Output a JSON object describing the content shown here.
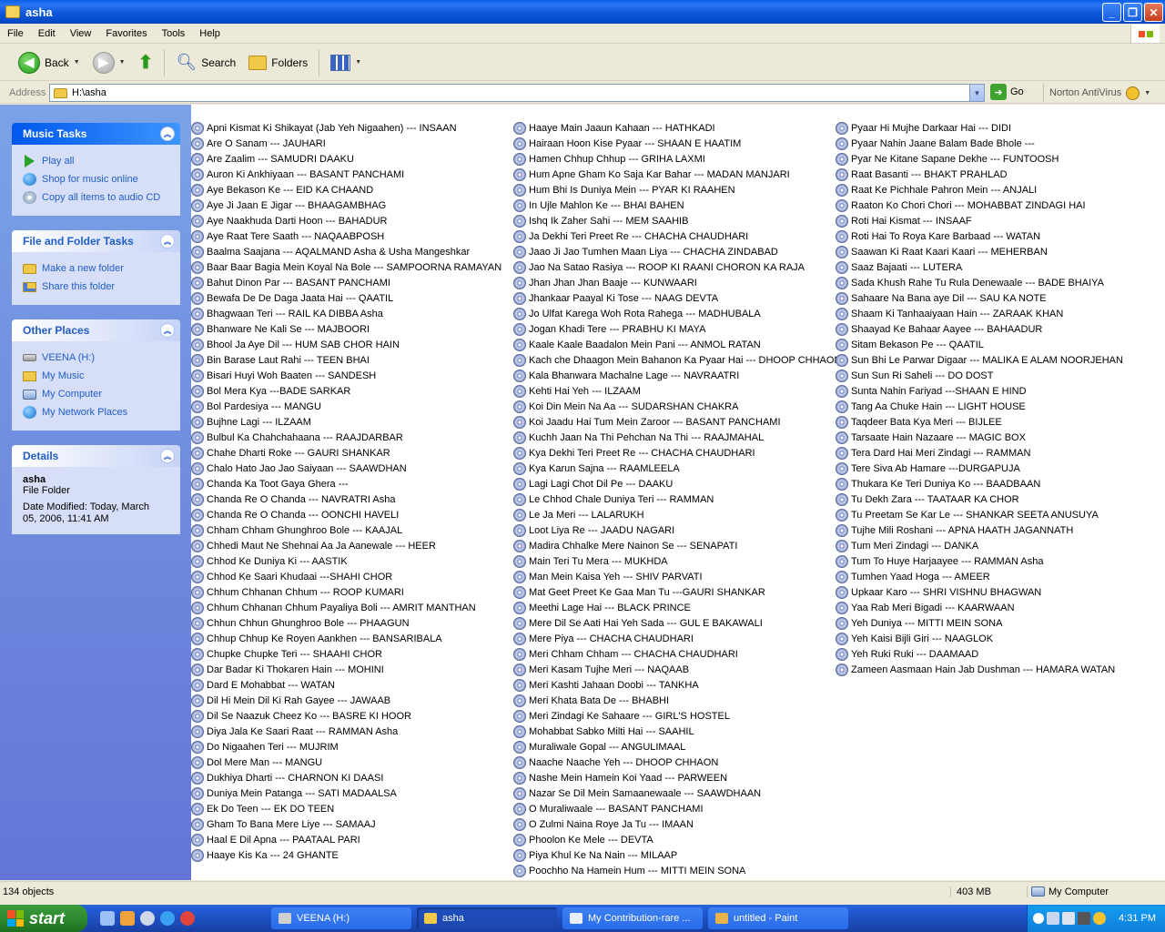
{
  "window": {
    "title": "asha"
  },
  "menu": [
    "File",
    "Edit",
    "View",
    "Favorites",
    "Tools",
    "Help"
  ],
  "toolbar": {
    "back": "Back",
    "search": "Search",
    "folders": "Folders"
  },
  "address": {
    "label": "Address",
    "path": "H:\\asha",
    "go": "Go",
    "norton": "Norton AntiVirus"
  },
  "taskpane": {
    "music_tasks": {
      "title": "Music Tasks",
      "items": [
        "Play all",
        "Shop for music online",
        "Copy all items to audio CD"
      ]
    },
    "file_folder_tasks": {
      "title": "File and Folder Tasks",
      "items": [
        "Make a new folder",
        "Share this folder"
      ]
    },
    "other_places": {
      "title": "Other Places",
      "items": [
        "VEENA (H:)",
        "My Music",
        "My Computer",
        "My Network Places"
      ]
    },
    "details": {
      "title": "Details",
      "name": "asha",
      "type": "File Folder",
      "modified_1": "Date Modified: Today, March",
      "modified_2": "05, 2006, 11:41 AM"
    }
  },
  "files": {
    "col1": [
      "Apni Kismat Ki Shikayat (Jab Yeh Nigaahen) --- INSAAN",
      "Are O Sanam --- JAUHARI",
      "Are Zaalim --- SAMUDRI DAAKU",
      "Auron Ki Ankhiyaan --- BASANT PANCHAMI",
      "Aye Bekason Ke --- EID KA CHAAND",
      "Aye Ji Jaan E Jigar --- BHAAGAMBHAG",
      "Aye Naakhuda Darti Hoon --- BAHADUR",
      "Aye Raat Tere Saath --- NAQAABPOSH",
      "Baalma Saajana --- AQALMAND   Asha & Usha Mangeshkar",
      "Baar Baar Bagia Mein Koyal Na Bole --- SAMPOORNA RAMAYAN",
      "Bahut Dinon Par --- BASANT PANCHAMI",
      "Bewafa De De Daga Jaata Hai --- QAATIL",
      "Bhagwaan Teri --- RAIL KA DIBBA  Asha",
      "Bhanware Ne Kali Se --- MAJBOORI",
      "Bhool Ja Aye Dil --- HUM SAB CHOR HAIN",
      "Bin Barase Laut Rahi --- TEEN BHAI",
      "Bisari Huyi Woh Baaten --- SANDESH",
      "Bol Mera Kya ---BADE SARKAR",
      "Bol Pardesiya --- MANGU",
      "Bujhne Lagi --- ILZAAM",
      "Bulbul Ka Chahchahaana --- RAAJDARBAR",
      "Chahe Dharti Roke --- GAURI SHANKAR",
      "Chalo Hato Jao Jao Saiyaan --- SAAWDHAN",
      "Chanda Ka Toot Gaya Ghera ---",
      "Chanda Re O Chanda --- NAVRATRI  Asha",
      "Chanda Re O Chanda --- OONCHI HAVELI",
      "Chham Chham Ghunghroo Bole --- KAAJAL",
      "Chhedi Maut Ne Shehnai Aa Ja Aanewale --- HEER",
      "Chhod Ke Duniya Ki --- AASTIK",
      "Chhod Ke Saari Khudaai ---SHAHI CHOR",
      "Chhum Chhanan Chhum --- ROOP KUMARI",
      "Chhum Chhanan Chhum Payaliya Boli --- AMRIT MANTHAN",
      "Chhun Chhun Ghunghroo Bole --- PHAAGUN",
      "Chhup Chhup Ke Royen Aankhen --- BANSARIBALA",
      "Chupke Chupke Teri --- SHAAHI CHOR",
      "Dar Badar Ki Thokaren Hain --- MOHINI",
      "Dard E Mohabbat --- WATAN",
      "Dil Hi Mein Dil Ki Rah Gayee --- JAWAAB",
      "Dil Se Naazuk Cheez Ko --- BASRE KI HOOR",
      "Diya Jala Ke Saari Raat --- RAMMAN  Asha",
      "Do Nigaahen Teri --- MUJRIM",
      "Dol Mere Man --- MANGU",
      "Dukhiya Dharti --- CHARNON KI DAASI",
      "Duniya Mein Patanga --- SATI MADAALSA",
      "Ek Do Teen --- EK DO TEEN",
      "Gham To Bana Mere Liye --- SAMAAJ",
      "Haal E Dil Apna --- PAATAAL PARI",
      "Haaye Kis Ka --- 24 GHANTE"
    ],
    "col2": [
      "Haaye Main Jaaun Kahaan --- HATHKADI",
      "Hairaan Hoon Kise Pyaar --- SHAAN E HAATIM",
      "Hamen Chhup Chhup --- GRIHA LAXMI",
      "Hum Apne Gham Ko Saja Kar Bahar --- MADAN MANJARI",
      "Hum Bhi Is Duniya Mein --- PYAR KI RAAHEN",
      "In Ujle Mahlon Ke --- BHAI BAHEN",
      "Ishq Ik Zaher Sahi --- MEM SAAHIB",
      "Ja Dekhi Teri Preet Re --- CHACHA CHAUDHARI",
      "Jaao Ji Jao Tumhen Maan Liya --- CHACHA ZINDABAD",
      "Jao Na Satao Rasiya --- ROOP KI RAANI CHORON KA RAJA",
      "Jhan Jhan Jhan Baaje --- KUNWAARI",
      "Jhankaar Paayal Ki Tose --- NAAG DEVTA",
      "Jo Ulfat Karega Woh Rota Rahega --- MADHUBALA",
      "Jogan Khadi Tere --- PRABHU KI MAYA",
      "Kaale Kaale Baadalon Mein Pani --- ANMOL RATAN",
      "Kach che Dhaagon Mein Bahanon Ka Pyaar Hai --- DHOOP CHHAON",
      "Kala Bhanwara Machalne Lage --- NAVRAATRI",
      "Kehti Hai Yeh --- ILZAAM",
      "Koi Din Mein Na Aa --- SUDARSHAN CHAKRA",
      "Koi Jaadu Hai Tum Mein Zaroor --- BASANT PANCHAMI",
      "Kuchh Jaan Na Thi Pehchan Na Thi --- RAAJMAHAL",
      "Kya Dekhi Teri Preet Re --- CHACHA CHAUDHARI",
      "Kya Karun Sajna --- RAAMLEELA",
      "Lagi Lagi Chot Dil Pe --- DAAKU",
      "Le Chhod Chale Duniya Teri --- RAMMAN",
      "Le Ja Meri --- LALARUKH",
      "Loot Liya Re --- JAADU NAGARI",
      "Madira Chhalke Mere Nainon Se --- SENAPATI",
      "Main Teri Tu Mera --- MUKHDA",
      "Man Mein Kaisa Yeh --- SHIV PARVATI",
      "Mat Geet Preet Ke Gaa Man Tu ---GAURI SHANKAR",
      "Meethi Lage Hai --- BLACK PRINCE",
      "Mere Dil Se Aati Hai Yeh Sada --- GUL E BAKAWALI",
      "Mere Piya --- CHACHA CHAUDHARI",
      "Meri Chham Chham --- CHACHA CHAUDHARI",
      "Meri Kasam Tujhe Meri --- NAQAAB",
      "Meri Kashti Jahaan Doobi --- TANKHA",
      "Meri Khata Bata De --- BHABHI",
      "Meri Zindagi Ke Sahaare --- GIRL'S HOSTEL",
      "Mohabbat Sabko Milti Hai --- SAAHIL",
      "Muraliwale Gopal --- ANGULIMAAL",
      "Naache Naache Yeh --- DHOOP CHHAON",
      "Nashe Mein Hamein Koi Yaad --- PARWEEN",
      "Nazar Se Dil Mein Samaanewaale --- SAAWDHAAN",
      "O Muraliwaale --- BASANT PANCHAMI",
      "O Zulmi Naina Roye Ja Tu --- IMAAN",
      "Phoolon Ke Mele --- DEVTA",
      "Piya Khul Ke Na Nain --- MILAAP",
      "Poochho Na Hamein Hum --- MITTI MEIN SONA"
    ],
    "col3": [
      "Pyaar Hi Mujhe Darkaar Hai --- DIDI",
      "Pyaar Nahin Jaane Balam Bade Bhole ---",
      "Pyar Ne Kitane Sapane Dekhe --- FUNTOOSH",
      "Raat Basanti --- BHAKT PRAHLAD",
      "Raat Ke Pichhale Pahron Mein --- ANJALI",
      "Raaton Ko Chori Chori --- MOHABBAT ZINDAGI HAI",
      "Roti Hai Kismat --- INSAAF",
      "Roti Hai To Roya Kare Barbaad --- WATAN",
      "Saawan Ki Raat Kaari Kaari --- MEHERBAN",
      "Saaz Bajaati --- LUTERA",
      "Sada Khush Rahe Tu Rula Denewaale --- BADE BHAIYA",
      "Sahaare Na Bana aye Dil --- SAU KA NOTE",
      "Shaam Ki Tanhaaiyaan Hain --- ZARAAK KHAN",
      "Shaayad Ke Bahaar Aayee --- BAHAADUR",
      "Sitam Bekason Pe --- QAATIL",
      "Sun Bhi Le Parwar Digaar --- MALIKA E ALAM NOORJEHAN",
      "Sun Sun Ri Saheli --- DO DOST",
      "Sunta Nahin Fariyad ---SHAAN E HIND",
      "Tang Aa Chuke Hain --- LIGHT HOUSE",
      "Taqdeer Bata Kya Meri --- BIJLEE",
      "Tarsaate Hain Nazaare --- MAGIC BOX",
      "Tera Dard Hai Meri Zindagi --- RAMMAN",
      "Tere Siva Ab Hamare ---DURGAPUJA",
      "Thukara Ke Teri Duniya Ko --- BAADBAAN",
      "Tu Dekh Zara --- TAATAAR KA CHOR",
      "Tu Preetam Se Kar Le --- SHANKAR SEETA ANUSUYA",
      "Tujhe Mili Roshani --- APNA HAATH JAGANNATH",
      "Tum Meri Zindagi --- DANKA",
      "Tum To Huye Harjaayee --- RAMMAN  Asha",
      "Tumhen Yaad Hoga --- AMEER",
      "Upkaar Karo --- SHRI VISHNU BHAGWAN",
      "Yaa Rab Meri Bigadi --- KAARWAAN",
      "Yeh Duniya --- MITTI MEIN SONA",
      "Yeh Kaisi Bijli Giri --- NAAGLOK",
      "Yeh Ruki Ruki --- DAAMAAD",
      "Zameen Aasmaan Hain Jab Dushman --- HAMARA WATAN"
    ]
  },
  "status": {
    "objects": "134 objects",
    "size": "403 MB",
    "location": "My Computer"
  },
  "taskbar": {
    "start": "start",
    "buttons": [
      "VEENA (H:)",
      "asha",
      "My Contribution-rare ...",
      "untitled - Paint"
    ],
    "clock": "4:31 PM"
  }
}
